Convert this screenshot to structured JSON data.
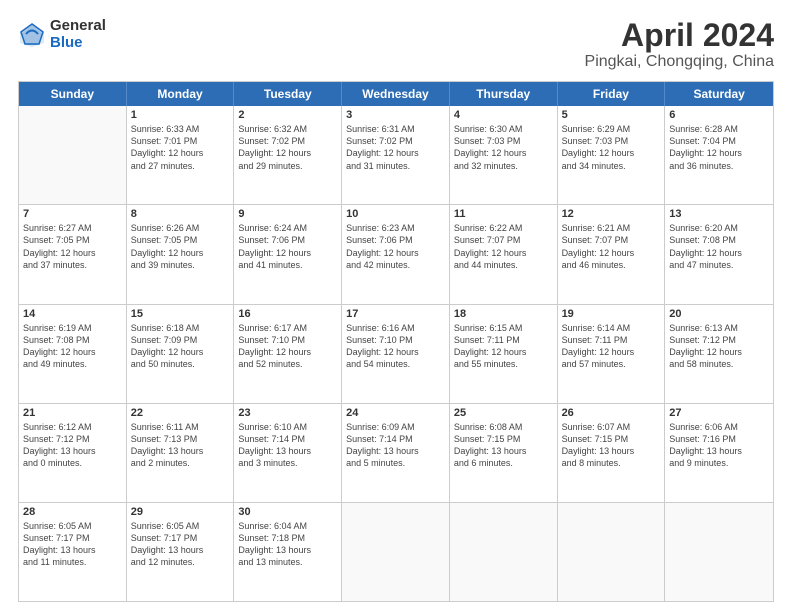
{
  "header": {
    "logo_general": "General",
    "logo_blue": "Blue",
    "title": "April 2024",
    "subtitle": "Pingkai, Chongqing, China"
  },
  "calendar": {
    "weekdays": [
      "Sunday",
      "Monday",
      "Tuesday",
      "Wednesday",
      "Thursday",
      "Friday",
      "Saturday"
    ],
    "weeks": [
      [
        {
          "day": "",
          "info": ""
        },
        {
          "day": "1",
          "info": "Sunrise: 6:33 AM\nSunset: 7:01 PM\nDaylight: 12 hours\nand 27 minutes."
        },
        {
          "day": "2",
          "info": "Sunrise: 6:32 AM\nSunset: 7:02 PM\nDaylight: 12 hours\nand 29 minutes."
        },
        {
          "day": "3",
          "info": "Sunrise: 6:31 AM\nSunset: 7:02 PM\nDaylight: 12 hours\nand 31 minutes."
        },
        {
          "day": "4",
          "info": "Sunrise: 6:30 AM\nSunset: 7:03 PM\nDaylight: 12 hours\nand 32 minutes."
        },
        {
          "day": "5",
          "info": "Sunrise: 6:29 AM\nSunset: 7:03 PM\nDaylight: 12 hours\nand 34 minutes."
        },
        {
          "day": "6",
          "info": "Sunrise: 6:28 AM\nSunset: 7:04 PM\nDaylight: 12 hours\nand 36 minutes."
        }
      ],
      [
        {
          "day": "7",
          "info": "Sunrise: 6:27 AM\nSunset: 7:05 PM\nDaylight: 12 hours\nand 37 minutes."
        },
        {
          "day": "8",
          "info": "Sunrise: 6:26 AM\nSunset: 7:05 PM\nDaylight: 12 hours\nand 39 minutes."
        },
        {
          "day": "9",
          "info": "Sunrise: 6:24 AM\nSunset: 7:06 PM\nDaylight: 12 hours\nand 41 minutes."
        },
        {
          "day": "10",
          "info": "Sunrise: 6:23 AM\nSunset: 7:06 PM\nDaylight: 12 hours\nand 42 minutes."
        },
        {
          "day": "11",
          "info": "Sunrise: 6:22 AM\nSunset: 7:07 PM\nDaylight: 12 hours\nand 44 minutes."
        },
        {
          "day": "12",
          "info": "Sunrise: 6:21 AM\nSunset: 7:07 PM\nDaylight: 12 hours\nand 46 minutes."
        },
        {
          "day": "13",
          "info": "Sunrise: 6:20 AM\nSunset: 7:08 PM\nDaylight: 12 hours\nand 47 minutes."
        }
      ],
      [
        {
          "day": "14",
          "info": "Sunrise: 6:19 AM\nSunset: 7:08 PM\nDaylight: 12 hours\nand 49 minutes."
        },
        {
          "day": "15",
          "info": "Sunrise: 6:18 AM\nSunset: 7:09 PM\nDaylight: 12 hours\nand 50 minutes."
        },
        {
          "day": "16",
          "info": "Sunrise: 6:17 AM\nSunset: 7:10 PM\nDaylight: 12 hours\nand 52 minutes."
        },
        {
          "day": "17",
          "info": "Sunrise: 6:16 AM\nSunset: 7:10 PM\nDaylight: 12 hours\nand 54 minutes."
        },
        {
          "day": "18",
          "info": "Sunrise: 6:15 AM\nSunset: 7:11 PM\nDaylight: 12 hours\nand 55 minutes."
        },
        {
          "day": "19",
          "info": "Sunrise: 6:14 AM\nSunset: 7:11 PM\nDaylight: 12 hours\nand 57 minutes."
        },
        {
          "day": "20",
          "info": "Sunrise: 6:13 AM\nSunset: 7:12 PM\nDaylight: 12 hours\nand 58 minutes."
        }
      ],
      [
        {
          "day": "21",
          "info": "Sunrise: 6:12 AM\nSunset: 7:12 PM\nDaylight: 13 hours\nand 0 minutes."
        },
        {
          "day": "22",
          "info": "Sunrise: 6:11 AM\nSunset: 7:13 PM\nDaylight: 13 hours\nand 2 minutes."
        },
        {
          "day": "23",
          "info": "Sunrise: 6:10 AM\nSunset: 7:14 PM\nDaylight: 13 hours\nand 3 minutes."
        },
        {
          "day": "24",
          "info": "Sunrise: 6:09 AM\nSunset: 7:14 PM\nDaylight: 13 hours\nand 5 minutes."
        },
        {
          "day": "25",
          "info": "Sunrise: 6:08 AM\nSunset: 7:15 PM\nDaylight: 13 hours\nand 6 minutes."
        },
        {
          "day": "26",
          "info": "Sunrise: 6:07 AM\nSunset: 7:15 PM\nDaylight: 13 hours\nand 8 minutes."
        },
        {
          "day": "27",
          "info": "Sunrise: 6:06 AM\nSunset: 7:16 PM\nDaylight: 13 hours\nand 9 minutes."
        }
      ],
      [
        {
          "day": "28",
          "info": "Sunrise: 6:05 AM\nSunset: 7:17 PM\nDaylight: 13 hours\nand 11 minutes."
        },
        {
          "day": "29",
          "info": "Sunrise: 6:05 AM\nSunset: 7:17 PM\nDaylight: 13 hours\nand 12 minutes."
        },
        {
          "day": "30",
          "info": "Sunrise: 6:04 AM\nSunset: 7:18 PM\nDaylight: 13 hours\nand 13 minutes."
        },
        {
          "day": "",
          "info": ""
        },
        {
          "day": "",
          "info": ""
        },
        {
          "day": "",
          "info": ""
        },
        {
          "day": "",
          "info": ""
        }
      ]
    ]
  }
}
